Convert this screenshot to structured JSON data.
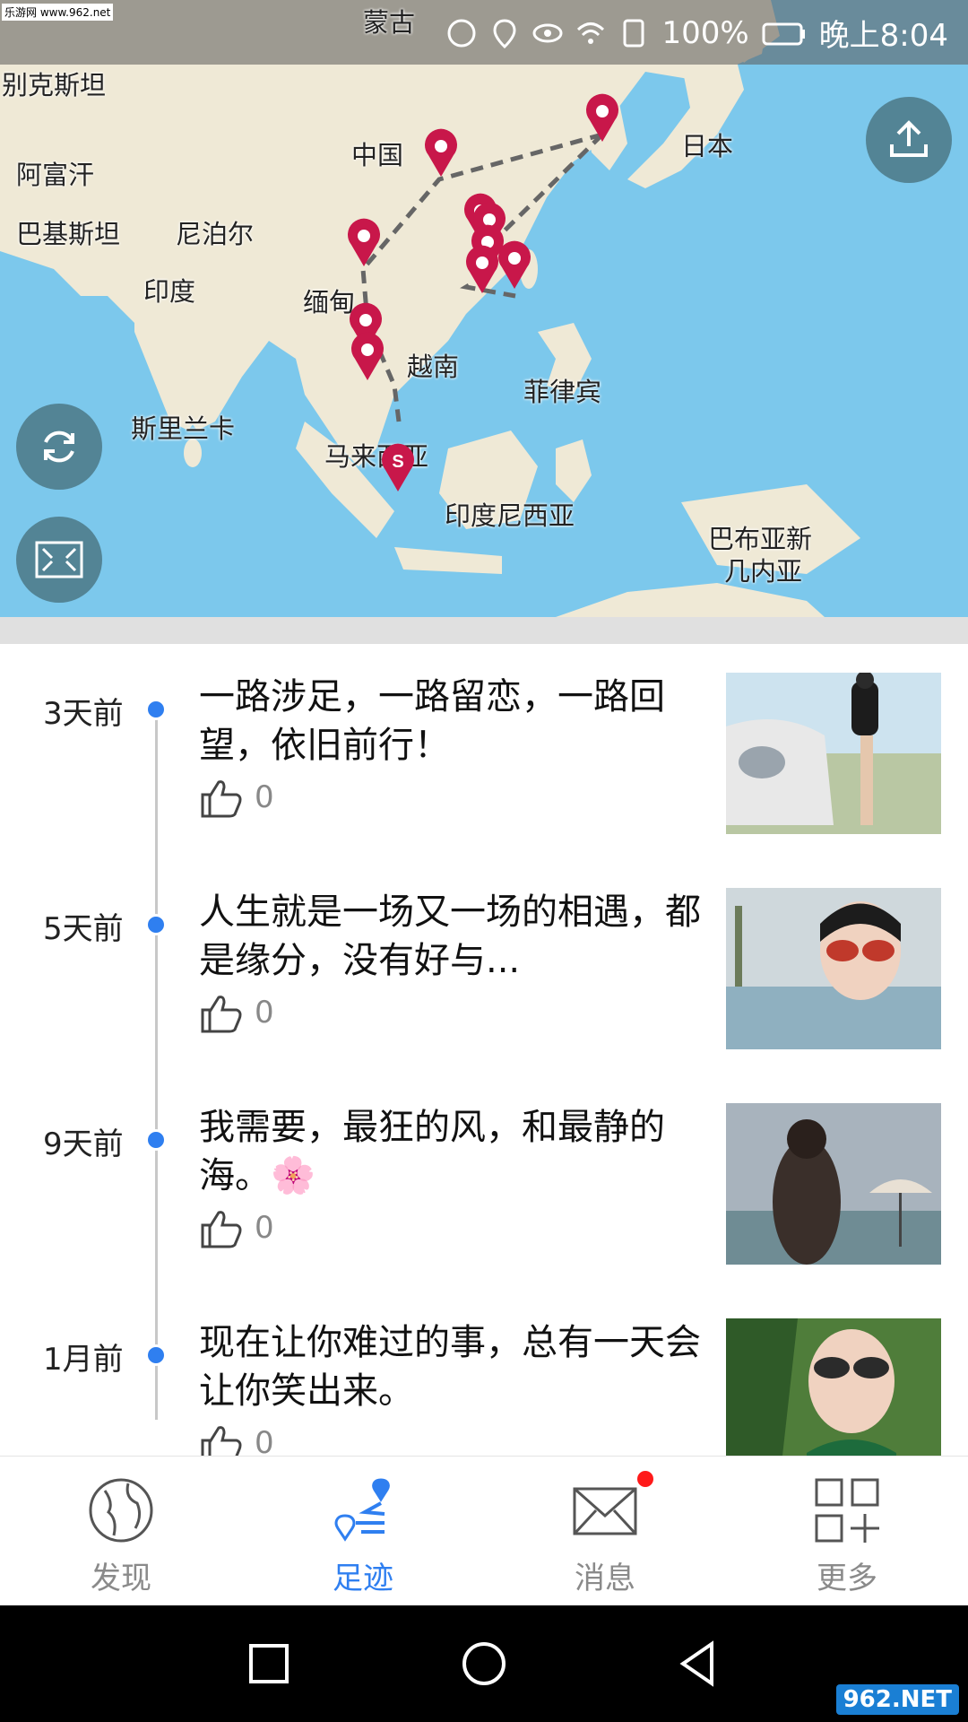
{
  "watermark_top": "乐游网 www.962.net",
  "status": {
    "battery": "100%",
    "time": "晚上8:04"
  },
  "map": {
    "labels": [
      {
        "text": "蒙古"
      },
      {
        "text": "别克斯坦"
      },
      {
        "text": "中国"
      },
      {
        "text": "日本"
      },
      {
        "text": "阿富汗"
      },
      {
        "text": "巴基斯坦"
      },
      {
        "text": "尼泊尔"
      },
      {
        "text": "印度"
      },
      {
        "text": "缅甸"
      },
      {
        "text": "越南"
      },
      {
        "text": "菲律宾"
      },
      {
        "text": "斯里兰卡"
      },
      {
        "text": "马来西亚"
      },
      {
        "text": "印度尼西亚"
      },
      {
        "text": "巴布亚新"
      },
      {
        "text": "几内亚"
      }
    ],
    "start_marker": "S"
  },
  "timeline": [
    {
      "date": "3天前",
      "text": "一路涉足，一路留恋，一路回望，依旧前行！",
      "likes": "0"
    },
    {
      "date": "5天前",
      "text": "人生就是一场又一场的相遇，都是缘分，没有好与...",
      "likes": "0"
    },
    {
      "date": "9天前",
      "text": "我需要，最狂的风，和最静的海。🌸",
      "likes": "0"
    },
    {
      "date": "1月前",
      "text": "现在让你难过的事，总有一天会让你笑出来。",
      "likes": "0"
    }
  ],
  "nav": [
    {
      "label": "发现",
      "icon": "globe-icon"
    },
    {
      "label": "足迹",
      "icon": "footprint-route-icon"
    },
    {
      "label": "消息",
      "icon": "envelope-icon"
    },
    {
      "label": "更多",
      "icon": "grid-plus-icon"
    }
  ],
  "corner_logo": "962.NET",
  "colors": {
    "accent": "#2f7ff0",
    "pin": "#c8174a",
    "notification": "#ff1a1a"
  }
}
